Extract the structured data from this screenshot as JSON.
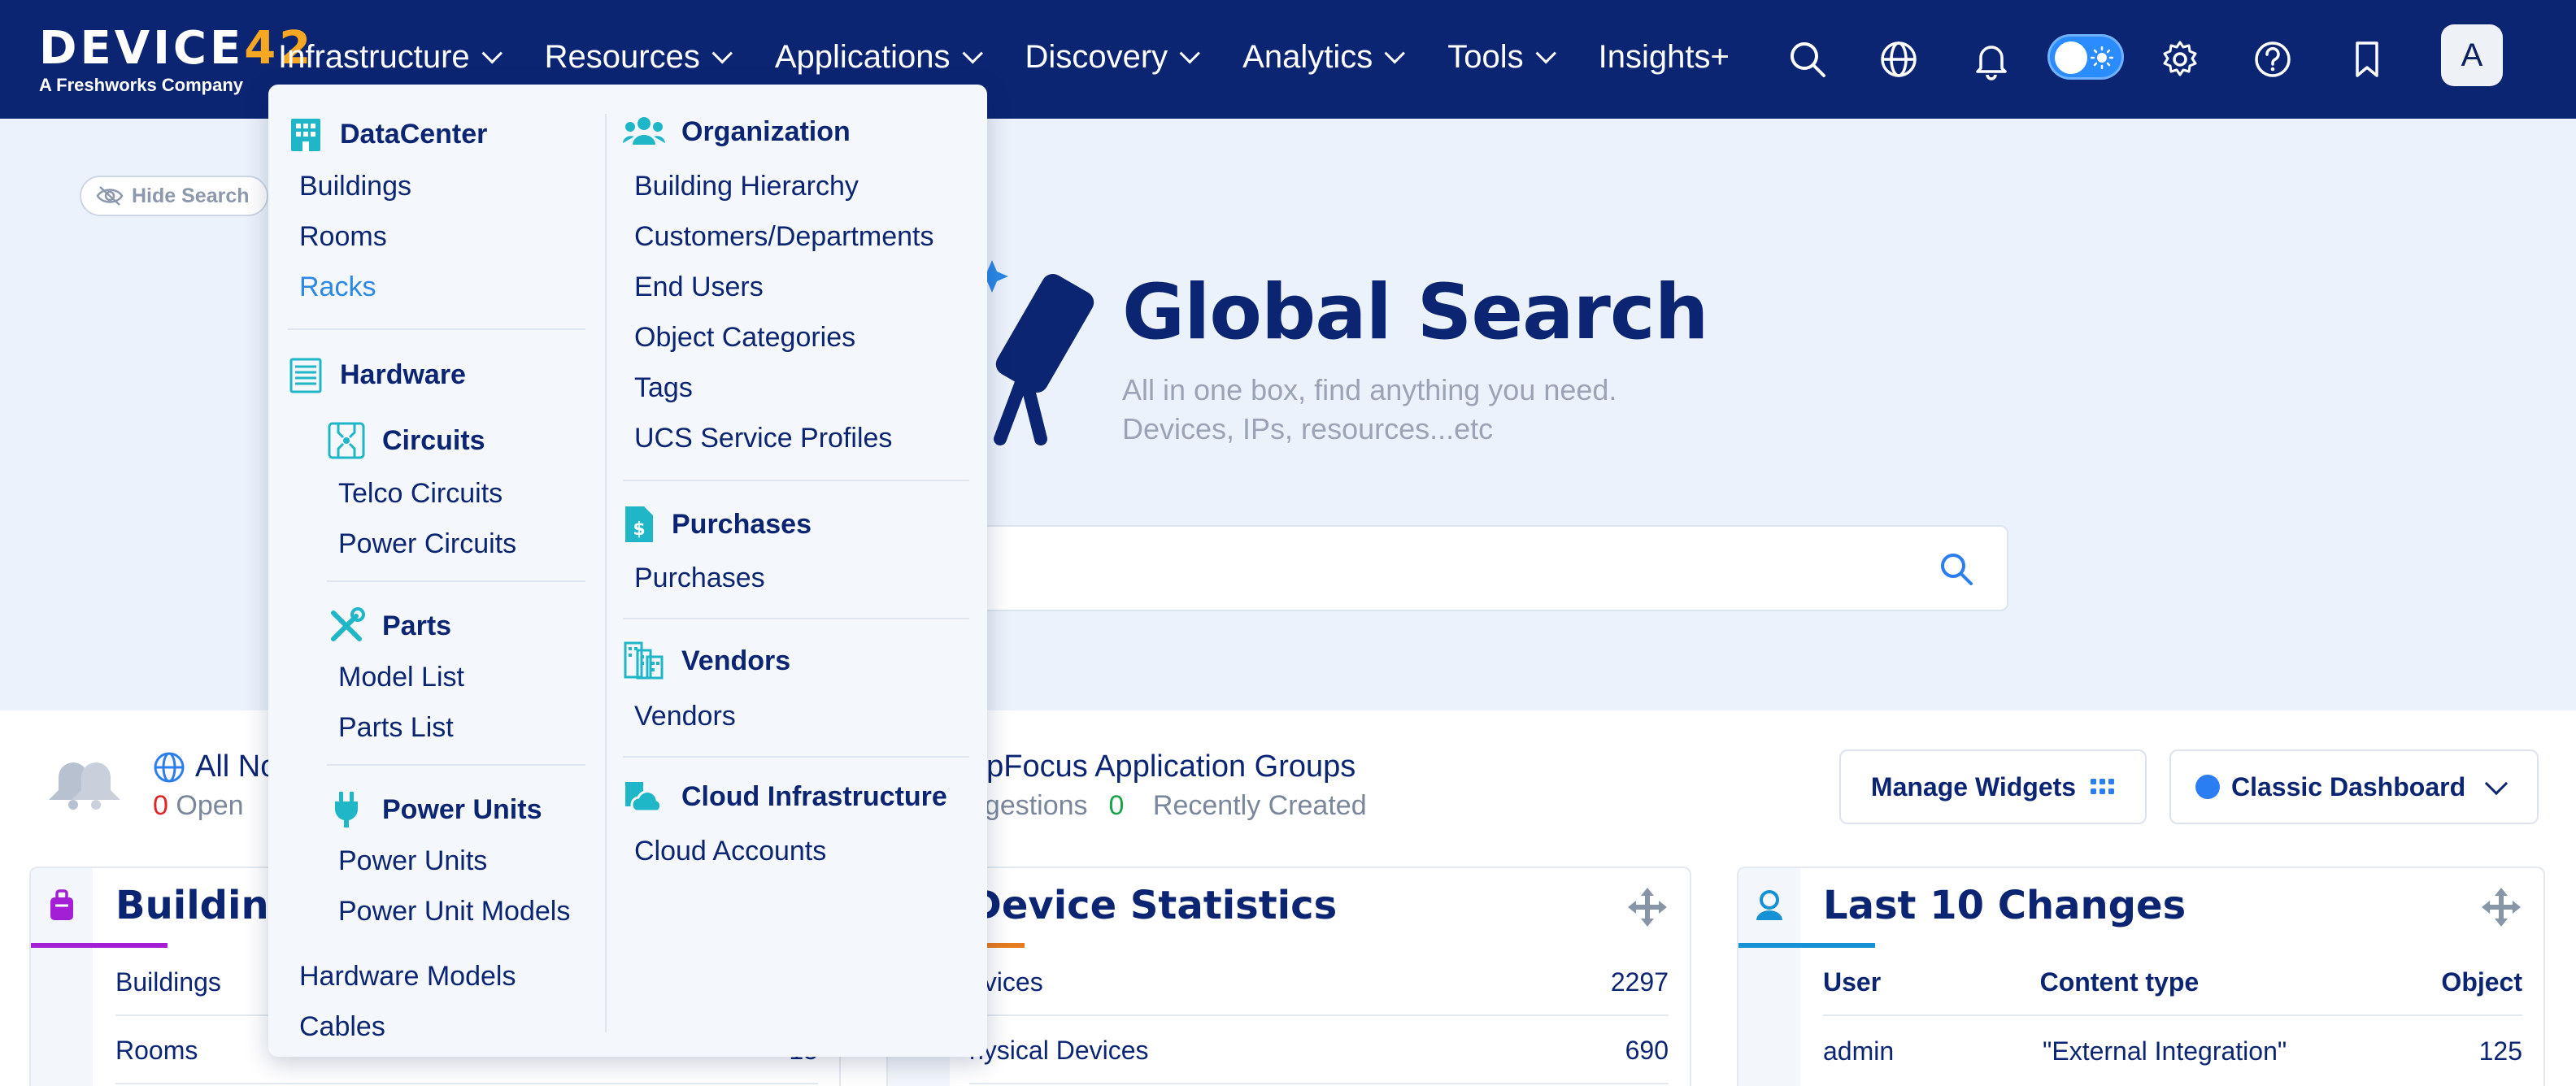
{
  "brand": {
    "name_main": "DEVICE",
    "name_num": "42",
    "subtitle": "A Freshworks Company"
  },
  "nav": {
    "items": [
      {
        "label": "Infrastructure",
        "has_chevron": true
      },
      {
        "label": "Resources",
        "has_chevron": true
      },
      {
        "label": "Applications",
        "has_chevron": true
      },
      {
        "label": "Discovery",
        "has_chevron": true
      },
      {
        "label": "Analytics",
        "has_chevron": true
      },
      {
        "label": "Tools",
        "has_chevron": true
      },
      {
        "label": "Insights+",
        "has_chevron": false
      }
    ],
    "icons": [
      "search-icon",
      "globe-icon",
      "bell-icon",
      "theme-toggle",
      "gear-icon",
      "help-icon",
      "bookmark-icon"
    ],
    "avatar_letter": "A"
  },
  "hero": {
    "hide_search_label": "Hide Search",
    "title": "Global Search",
    "subtitle_line1": "All in one box, find anything you need.",
    "subtitle_line2": "Devices, IPs, resources...etc",
    "search_value": ""
  },
  "stats": {
    "notifications": {
      "title_visible": "All No",
      "open_count": "0",
      "open_label": "Open"
    },
    "appfocus": {
      "title_visible": "opFocus Application Groups",
      "suggestions_label": "ggestions",
      "recent_count": "0",
      "recent_label": "Recently Created"
    },
    "manage_widgets_label": "Manage Widgets",
    "dashboard_label": "Classic Dashboard"
  },
  "widgets": {
    "buildings": {
      "title_visible": "Building",
      "rows": [
        {
          "label": "Buildings",
          "value": ""
        },
        {
          "label": "Rooms",
          "value": "15"
        }
      ]
    },
    "device_stats": {
      "title_visible": "Device Statistics",
      "rows": [
        {
          "label": "evices",
          "value": "2297"
        },
        {
          "label": "hysical Devices",
          "value": "690"
        }
      ]
    },
    "last_changes": {
      "title": "Last 10 Changes",
      "columns": [
        "User",
        "Content type",
        "Object"
      ],
      "rows": [
        {
          "user": "admin",
          "content_type": "\"External Integration\"",
          "object": "125"
        }
      ]
    }
  },
  "dropdown": {
    "left": {
      "datacenter": {
        "heading": "DataCenter",
        "links": [
          "Buildings",
          "Rooms",
          "Racks"
        ],
        "active": "Racks"
      },
      "hardware": {
        "heading": "Hardware"
      },
      "circuits": {
        "heading": "Circuits",
        "links": [
          "Telco Circuits",
          "Power Circuits"
        ]
      },
      "parts": {
        "heading": "Parts",
        "links": [
          "Model List",
          "Parts List"
        ]
      },
      "power_units": {
        "heading": "Power Units",
        "links": [
          "Power Units",
          "Power Unit Models"
        ]
      },
      "extra_links": [
        "Hardware Models",
        "Cables"
      ]
    },
    "right": {
      "organization": {
        "heading": "Organization",
        "links": [
          "Building Hierarchy",
          "Customers/Departments",
          "End Users",
          "Object Categories",
          "Tags",
          "UCS Service Profiles"
        ]
      },
      "purchases": {
        "heading": "Purchases",
        "links": [
          "Purchases"
        ]
      },
      "vendors": {
        "heading": "Vendors",
        "links": [
          "Vendors"
        ]
      },
      "cloud": {
        "heading": "Cloud Infrastructure",
        "links": [
          "Cloud Accounts"
        ]
      }
    }
  },
  "colors": {
    "nav_bg": "#0b2573",
    "accent_teal": "#1fb7c7",
    "accent_link_active": "#2b88e6",
    "brand_orange": "#f7a823",
    "widget_purple": "#a21fd6",
    "widget_orange": "#e57a1f",
    "widget_blue": "#1591d6"
  }
}
